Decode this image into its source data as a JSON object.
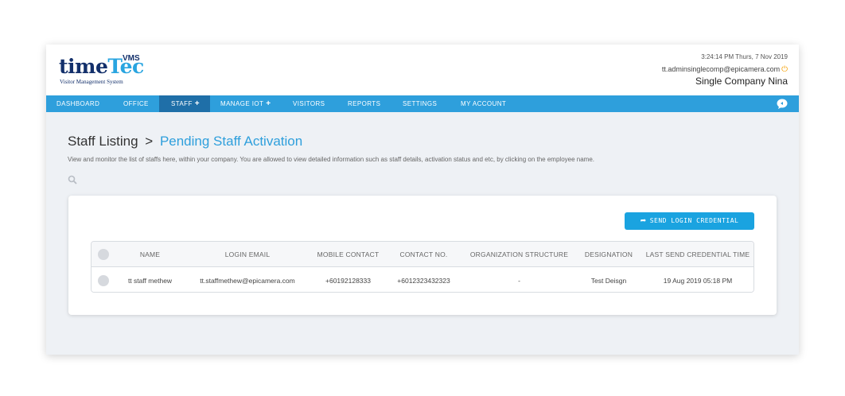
{
  "header": {
    "logo_time": "time",
    "logo_tec": "Tec",
    "logo_vms": "VMS",
    "logo_sub": "Visitor Management System",
    "datetime": "3:24:14 PM Thurs, 7 Nov 2019",
    "email": "tt.adminsinglecomp@epicamera.com",
    "user_name": "Single Company Nina"
  },
  "nav": {
    "items": [
      {
        "label": "DASHBOARD"
      },
      {
        "label": "OFFICE"
      },
      {
        "label": "STAFF",
        "plus": "+",
        "active": true
      },
      {
        "label": "MANAGE IOT",
        "plus": "+"
      },
      {
        "label": "VISITORS"
      },
      {
        "label": "REPORTS"
      },
      {
        "label": "SETTINGS"
      },
      {
        "label": "MY ACCOUNT"
      }
    ]
  },
  "page": {
    "breadcrumb_parent": "Staff Listing",
    "breadcrumb_sep": ">",
    "breadcrumb_current": "Pending Staff Activation",
    "description": "View and monitor the list of staffs here, within your company. You are allowed to view detailed information such as staff details, activation status and etc, by clicking on the employee name."
  },
  "actions": {
    "send_button_label": "SEND LOGIN CREDENTIAL"
  },
  "table": {
    "headers": [
      "NAME",
      "LOGIN EMAIL",
      "MOBILE CONTACT",
      "CONTACT NO.",
      "ORGANIZATION STRUCTURE",
      "DESIGNATION",
      "LAST SEND CREDENTIAL TIME"
    ],
    "rows": [
      [
        "tt staff methew",
        "tt.staffmethew@epicamera.com",
        "+60192128333",
        "+6012323432323",
        "-",
        "Test Deisgn",
        "19 Aug 2019 05:18 PM"
      ]
    ]
  },
  "colors": {
    "nav_bg": "#2e9fdc",
    "nav_active": "#1f6fa8",
    "accent": "#1aa3e0",
    "power_icon": "#f5a000"
  }
}
